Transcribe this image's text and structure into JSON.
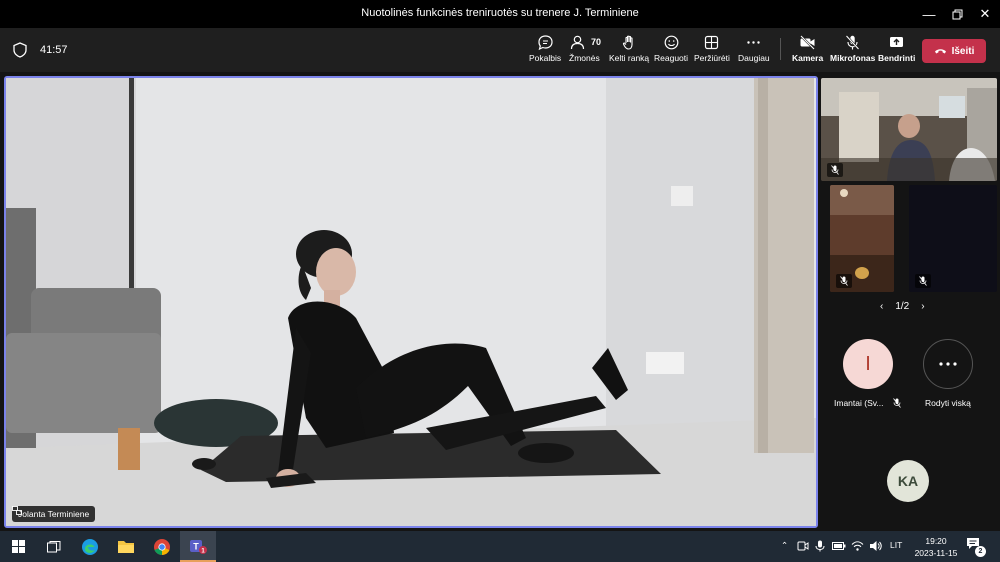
{
  "window": {
    "title": "Nuotolinės funkcinės treniruotės su trenere J. Terminiene"
  },
  "toolbar": {
    "timer": "41:57",
    "people_count": "70",
    "buttons": [
      {
        "key": "chat",
        "label": "Pokalbis",
        "icon": "chat-icon"
      },
      {
        "key": "people",
        "label": "Žmonės",
        "icon": "people-icon"
      },
      {
        "key": "raise",
        "label": "Kelti ranką",
        "icon": "raise-hand-icon"
      },
      {
        "key": "react",
        "label": "Reaguoti",
        "icon": "smile-icon"
      },
      {
        "key": "view",
        "label": "Peržiūrėti",
        "icon": "view-icon"
      },
      {
        "key": "more",
        "label": "Daugiau",
        "icon": "more-icon"
      },
      {
        "key": "camera",
        "label": "Kamera",
        "icon": "camera-off-icon"
      },
      {
        "key": "mic",
        "label": "Mikrofonas",
        "icon": "mic-off-icon"
      },
      {
        "key": "share",
        "label": "Bendrinti",
        "icon": "share-icon"
      }
    ],
    "leave_label": "Išeiti",
    "leave_color": "#c4314b"
  },
  "main_video": {
    "name": "Jolanta Terminiene",
    "border_color": "#7b83eb"
  },
  "side": {
    "pager": "1/2",
    "participants": [
      {
        "initial": "I",
        "name": "Imantai (Sv...",
        "avatar_bg": "#f6d8d5",
        "avatar_fg": "#b03a2e"
      },
      {
        "initial": "KA",
        "name": "",
        "avatar_bg": "#e2e5d9",
        "avatar_fg": "#3c4a3a"
      }
    ],
    "show_all_label": "Rodyti viską"
  },
  "taskbar": {
    "language": "LIT",
    "time": "19:20",
    "date": "2023-11-15",
    "notification_count": "2",
    "teams_badge": "1"
  }
}
